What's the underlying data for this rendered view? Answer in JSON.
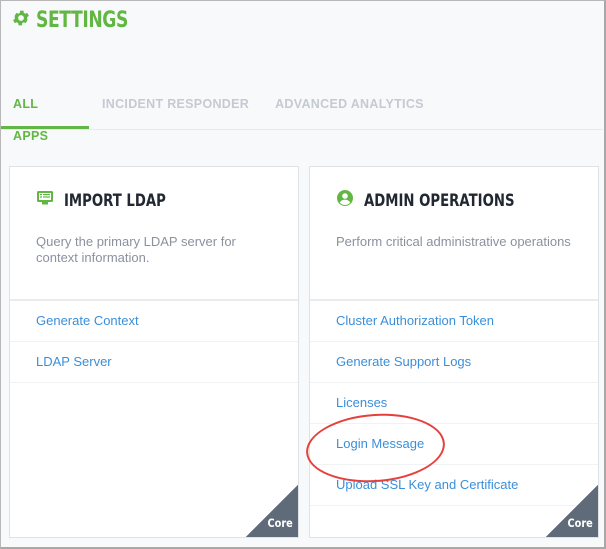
{
  "header": {
    "title": "SETTINGS",
    "icon": "gear-icon",
    "accent_color": "#62b744"
  },
  "tabs": [
    {
      "label": "ALL APPS",
      "active": true
    },
    {
      "label": "INCIDENT RESPONDER",
      "active": false
    },
    {
      "label": "ADVANCED ANALYTICS",
      "active": false
    }
  ],
  "cards": [
    {
      "title": "IMPORT LDAP",
      "icon": "monitor-list-icon",
      "description": "Query the primary LDAP server for context information.",
      "links": [
        "Generate Context",
        "LDAP Server"
      ],
      "badge": "Core"
    },
    {
      "title": "ADMIN OPERATIONS",
      "icon": "user-circle-icon",
      "description": "Perform critical administrative operations",
      "links": [
        "Cluster Authorization Token",
        "Generate Support Logs",
        "Licenses",
        "Login Message",
        "Upload SSL Key and Certificate"
      ],
      "badge": "Core",
      "highlighted_link": "Login Message"
    }
  ],
  "colors": {
    "link": "#3b8fd9",
    "badge_bg": "#5f6b79",
    "highlight": "#e5403c"
  }
}
